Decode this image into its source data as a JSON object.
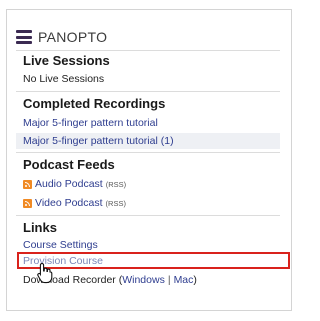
{
  "header": {
    "brand": "PANOPTO",
    "menu_icon": "hamburger-menu-icon"
  },
  "live_sessions": {
    "title": "Live Sessions",
    "empty_text": "No Live Sessions"
  },
  "completed_recordings": {
    "title": "Completed Recordings",
    "items": [
      "Major 5-finger pattern tutorial",
      "Major 5-finger pattern tutorial (1)"
    ]
  },
  "podcast_feeds": {
    "title": "Podcast Feeds",
    "audio": {
      "label": "Audio Podcast",
      "tag": "(RSS)"
    },
    "video": {
      "label": "Video Podcast",
      "tag": "(RSS)"
    },
    "icon": "rss-icon"
  },
  "links": {
    "title": "Links",
    "course_settings": "Course Settings",
    "provision_course": "Provision Course",
    "download_prefix": "Download Recorder (",
    "windows": "Windows",
    "separator": "|",
    "mac": "Mac",
    "download_suffix": ")"
  },
  "colors": {
    "link": "#2e3d8f",
    "highlight": "#d9221c",
    "rss": "#f08a24",
    "brand": "#3b2a52"
  }
}
